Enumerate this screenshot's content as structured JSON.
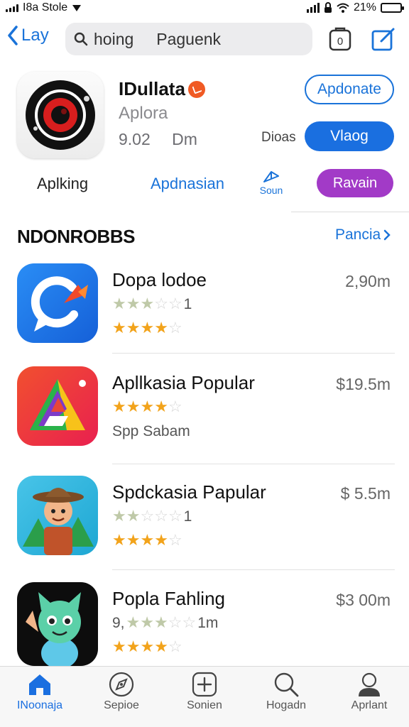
{
  "status_bar": {
    "carrier": "I8a Stole",
    "battery_percent": "21%",
    "battery_level": 0.21
  },
  "nav": {
    "back_label": "Lay",
    "search_value": "hoing     Paguenk",
    "badge_count": "0"
  },
  "app": {
    "title": "IDullata",
    "subtitle": "Aplora",
    "rating": "9.02",
    "size": "Dm",
    "outline_button": "Apdonate",
    "download_label": "Dioas",
    "primary_button": "Vlaog",
    "sub_left": "Aplking",
    "sub_mid": "Apdnasian",
    "share_label": "Soun",
    "purple_button": "Ravain"
  },
  "section": {
    "title": "NDONROBBS",
    "link": "Pancia"
  },
  "items": [
    {
      "name": "Dopa lodoe",
      "price": "2,90m",
      "line2_stars": 3,
      "line2_text": "1",
      "line3_stars": 4,
      "line3_text": "",
      "icon": "blue-chat-icon"
    },
    {
      "name": "Apllkasia Popular",
      "price": "$19.5m",
      "line2_stars": 4,
      "line2_text": "",
      "line3_stars": 0,
      "line3_text": "Spp Sabam",
      "icon": "triangle-app-icon"
    },
    {
      "name": "Spdckasia Papular",
      "price": "$ 5.5m",
      "line2_stars": 2,
      "line2_text": "1",
      "line3_stars": 4,
      "line3_text": "",
      "icon": "cowboy-game-icon"
    },
    {
      "name": "Popla Fahling",
      "price": "$3 00m",
      "line2_stars": 3,
      "line2_text": "9,",
      "line2_suffix": "1m",
      "line3_stars": 4,
      "line3_text": "",
      "icon": "cat-character-icon"
    }
  ],
  "tabs": [
    {
      "label": "INoonaja",
      "icon": "home-icon",
      "active": true
    },
    {
      "label": "Sepioe",
      "icon": "compass-icon",
      "active": false
    },
    {
      "label": "Sonien",
      "icon": "plus-square-icon",
      "active": false
    },
    {
      "label": "Hogadn",
      "icon": "search-icon",
      "active": false
    },
    {
      "label": "Aprlant",
      "icon": "person-icon",
      "active": false
    }
  ],
  "colors": {
    "accent": "#1a73d9",
    "primary_button": "#1a6fe0",
    "purple_button": "#a23ac7",
    "star": "#f2a31b"
  }
}
